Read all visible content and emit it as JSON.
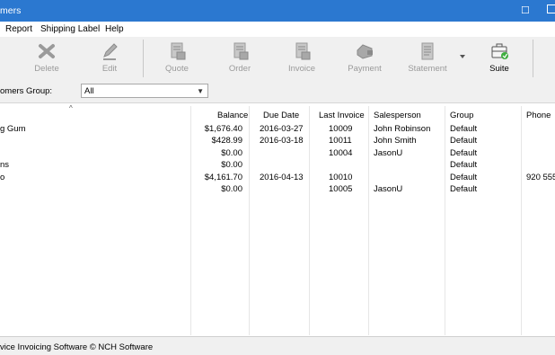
{
  "window": {
    "title": "mers"
  },
  "menu": [
    "Report",
    "Shipping Label",
    "Help"
  ],
  "toolbar": {
    "buttons": [
      {
        "label": "Delete",
        "icon": "delete-icon"
      },
      {
        "label": "Edit",
        "icon": "edit-icon"
      },
      {
        "label": "Quote",
        "icon": "quote-icon"
      },
      {
        "label": "Order",
        "icon": "order-icon"
      },
      {
        "label": "Invoice",
        "icon": "invoice-icon"
      },
      {
        "label": "Payment",
        "icon": "payment-icon"
      },
      {
        "label": "Statement",
        "icon": "statement-icon"
      },
      {
        "label": "Suite",
        "icon": "suite-icon"
      }
    ]
  },
  "filter": {
    "label": "omers Group:",
    "selected": "All"
  },
  "table": {
    "columns": [
      "Balance",
      "Due Date",
      "Last Invoice",
      "Salesperson",
      "Group",
      "Phone"
    ],
    "rows": [
      {
        "name": "g Gum",
        "balance": "$1,676.40",
        "due": "2016-03-27",
        "invoice": "10009",
        "salesperson": "John Robinson",
        "group": "Default",
        "phone": ""
      },
      {
        "name": "",
        "balance": "$428.99",
        "due": "2016-03-18",
        "invoice": "10011",
        "salesperson": "John Smith",
        "group": "Default",
        "phone": ""
      },
      {
        "name": "",
        "balance": "$0.00",
        "due": "",
        "invoice": "10004",
        "salesperson": "JasonU",
        "group": "Default",
        "phone": ""
      },
      {
        "name": "ns",
        "balance": "$0.00",
        "due": "",
        "invoice": "",
        "salesperson": "",
        "group": "Default",
        "phone": ""
      },
      {
        "name": "o",
        "balance": "$4,161.70",
        "due": "2016-04-13",
        "invoice": "10010",
        "salesperson": "",
        "group": "Default",
        "phone": "920 555"
      },
      {
        "name": "",
        "balance": "$0.00",
        "due": "",
        "invoice": "10005",
        "salesperson": "JasonU",
        "group": "Default",
        "phone": ""
      }
    ]
  },
  "status": {
    "text": "vice Invoicing Software © NCH Software"
  }
}
